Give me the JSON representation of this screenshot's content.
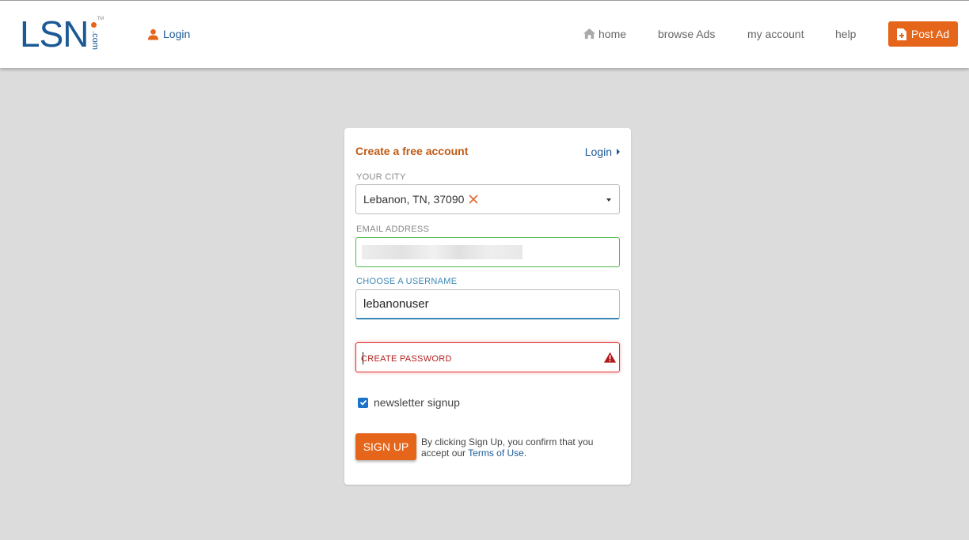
{
  "header": {
    "logo_text": "LSN",
    "logo_suffix": ".com",
    "logo_tm": "TM",
    "login_label": "Login",
    "nav": [
      {
        "label": "home"
      },
      {
        "label": "browse Ads"
      },
      {
        "label": "my account"
      },
      {
        "label": "help"
      }
    ],
    "post_ad_label": "Post Ad"
  },
  "form": {
    "title": "Create a free account",
    "login_link": "Login",
    "city": {
      "label": "YOUR CITY",
      "value": "Lebanon, TN, 37090"
    },
    "email": {
      "label": "EMAIL ADDRESS",
      "value": ""
    },
    "username": {
      "label": "CHOOSE A USERNAME",
      "value": "lebanonuser"
    },
    "password": {
      "placeholder": "CREATE PASSWORD",
      "status": "error"
    },
    "newsletter": {
      "label": "newsletter signup",
      "checked": true
    },
    "signup_label": "SIGN UP",
    "terms_prefix": "By clicking Sign Up, you confirm that you accept our ",
    "terms_link": "Terms of Use",
    "terms_suffix": "."
  },
  "colors": {
    "brand_blue": "#1c5a96",
    "accent_orange": "#e5651b",
    "title_orange": "#c05a14",
    "error_red": "#d33333",
    "valid_green": "#4cba4c",
    "background": "#dcdcdc"
  },
  "icons": {
    "user": "user-icon",
    "home": "home-icon",
    "post_ad": "document-plus-icon",
    "clear": "close-icon",
    "warning": "warning-icon",
    "check": "check-icon"
  }
}
